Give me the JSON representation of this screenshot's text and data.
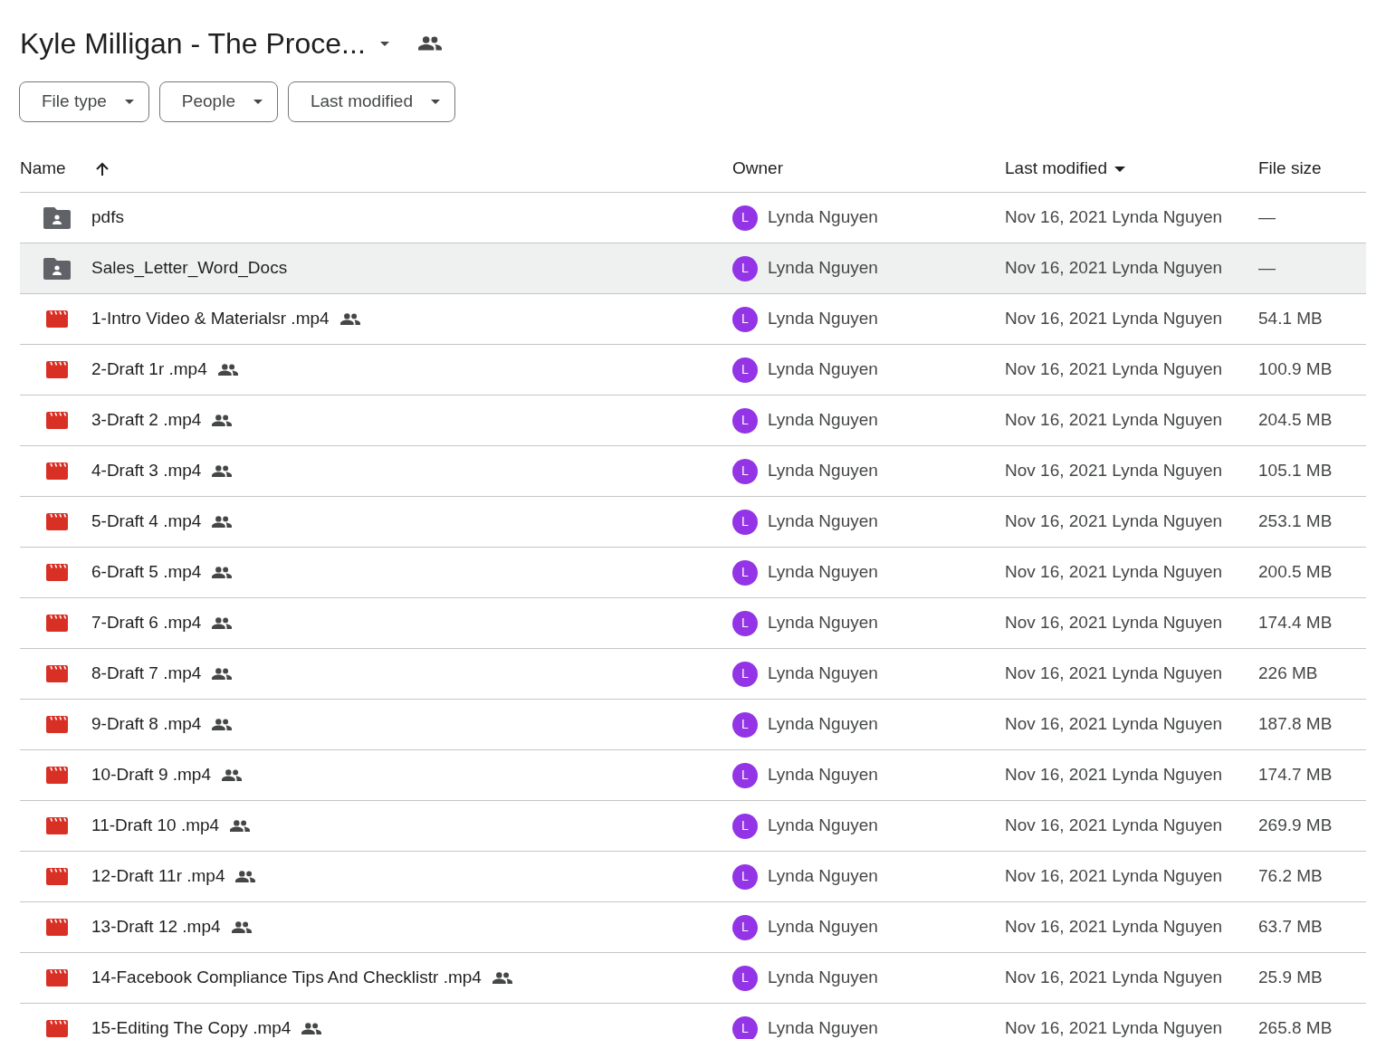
{
  "title": "Kyle Milligan - The Proce...",
  "filters": [
    "File type",
    "People",
    "Last modified"
  ],
  "columns": [
    {
      "label": "Name",
      "kind": "sort",
      "ascending": true
    },
    {
      "label": "Owner",
      "kind": "plain"
    },
    {
      "label": "Last modified",
      "kind": "menu"
    },
    {
      "label": "File size",
      "kind": "plain"
    }
  ],
  "rows": [
    {
      "kind": "folder",
      "name": "pdfs",
      "shared": false,
      "selected": false,
      "owner_initial": "L",
      "owner": "Lynda Nguyen",
      "modified": "Nov 16, 2021 Lynda Nguyen",
      "size": "—"
    },
    {
      "kind": "folder",
      "name": "Sales_Letter_Word_Docs",
      "shared": false,
      "selected": true,
      "owner_initial": "L",
      "owner": "Lynda Nguyen",
      "modified": "Nov 16, 2021 Lynda Nguyen",
      "size": "—"
    },
    {
      "kind": "video",
      "name": "1-Intro Video & Materialsr .mp4",
      "shared": true,
      "selected": false,
      "owner_initial": "L",
      "owner": "Lynda Nguyen",
      "modified": "Nov 16, 2021 Lynda Nguyen",
      "size": "54.1 MB"
    },
    {
      "kind": "video",
      "name": "2-Draft 1r .mp4",
      "shared": true,
      "selected": false,
      "owner_initial": "L",
      "owner": "Lynda Nguyen",
      "modified": "Nov 16, 2021 Lynda Nguyen",
      "size": "100.9 MB"
    },
    {
      "kind": "video",
      "name": "3-Draft 2 .mp4",
      "shared": true,
      "selected": false,
      "owner_initial": "L",
      "owner": "Lynda Nguyen",
      "modified": "Nov 16, 2021 Lynda Nguyen",
      "size": "204.5 MB"
    },
    {
      "kind": "video",
      "name": "4-Draft 3 .mp4",
      "shared": true,
      "selected": false,
      "owner_initial": "L",
      "owner": "Lynda Nguyen",
      "modified": "Nov 16, 2021 Lynda Nguyen",
      "size": "105.1 MB"
    },
    {
      "kind": "video",
      "name": "5-Draft 4 .mp4",
      "shared": true,
      "selected": false,
      "owner_initial": "L",
      "owner": "Lynda Nguyen",
      "modified": "Nov 16, 2021 Lynda Nguyen",
      "size": "253.1 MB"
    },
    {
      "kind": "video",
      "name": "6-Draft 5 .mp4",
      "shared": true,
      "selected": false,
      "owner_initial": "L",
      "owner": "Lynda Nguyen",
      "modified": "Nov 16, 2021 Lynda Nguyen",
      "size": "200.5 MB"
    },
    {
      "kind": "video",
      "name": "7-Draft 6 .mp4",
      "shared": true,
      "selected": false,
      "owner_initial": "L",
      "owner": "Lynda Nguyen",
      "modified": "Nov 16, 2021 Lynda Nguyen",
      "size": "174.4 MB"
    },
    {
      "kind": "video",
      "name": "8-Draft 7 .mp4",
      "shared": true,
      "selected": false,
      "owner_initial": "L",
      "owner": "Lynda Nguyen",
      "modified": "Nov 16, 2021 Lynda Nguyen",
      "size": "226 MB"
    },
    {
      "kind": "video",
      "name": "9-Draft 8 .mp4",
      "shared": true,
      "selected": false,
      "owner_initial": "L",
      "owner": "Lynda Nguyen",
      "modified": "Nov 16, 2021 Lynda Nguyen",
      "size": "187.8 MB"
    },
    {
      "kind": "video",
      "name": "10-Draft 9 .mp4",
      "shared": true,
      "selected": false,
      "owner_initial": "L",
      "owner": "Lynda Nguyen",
      "modified": "Nov 16, 2021 Lynda Nguyen",
      "size": "174.7 MB"
    },
    {
      "kind": "video",
      "name": "11-Draft 10 .mp4",
      "shared": true,
      "selected": false,
      "owner_initial": "L",
      "owner": "Lynda Nguyen",
      "modified": "Nov 16, 2021 Lynda Nguyen",
      "size": "269.9 MB"
    },
    {
      "kind": "video",
      "name": "12-Draft 11r .mp4",
      "shared": true,
      "selected": false,
      "owner_initial": "L",
      "owner": "Lynda Nguyen",
      "modified": "Nov 16, 2021 Lynda Nguyen",
      "size": "76.2 MB"
    },
    {
      "kind": "video",
      "name": "13-Draft 12 .mp4",
      "shared": true,
      "selected": false,
      "owner_initial": "L",
      "owner": "Lynda Nguyen",
      "modified": "Nov 16, 2021 Lynda Nguyen",
      "size": "63.7 MB"
    },
    {
      "kind": "video",
      "name": "14-Facebook Compliance Tips And Checklistr .mp4",
      "shared": true,
      "selected": false,
      "owner_initial": "L",
      "owner": "Lynda Nguyen",
      "modified": "Nov 16, 2021 Lynda Nguyen",
      "size": "25.9 MB"
    },
    {
      "kind": "video",
      "name": "15-Editing The Copy .mp4",
      "shared": true,
      "selected": false,
      "owner_initial": "L",
      "owner": "Lynda Nguyen",
      "modified": "Nov 16, 2021 Lynda Nguyen",
      "size": "265.8 MB"
    }
  ]
}
